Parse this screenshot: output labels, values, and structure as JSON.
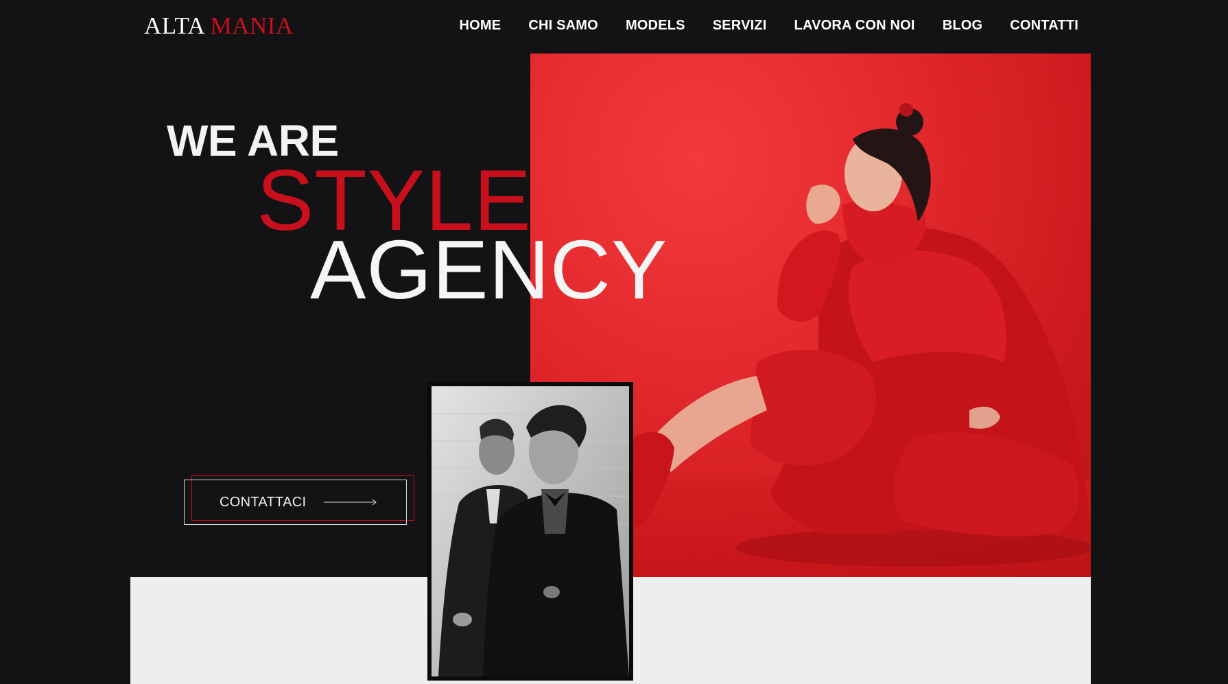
{
  "logo": {
    "part1": "ALTA",
    "part2": "MANIA"
  },
  "nav": {
    "items": [
      {
        "label": "HOME"
      },
      {
        "label": "CHI SAMO"
      },
      {
        "label": "MODELS"
      },
      {
        "label": "SERVIZI"
      },
      {
        "label": "LAVORA CON NOI"
      },
      {
        "label": "BLOG"
      },
      {
        "label": "CONTATTI"
      }
    ]
  },
  "hero": {
    "line1": "WE ARE",
    "line2": "STYLE",
    "line3": "AGENCY",
    "cta_label": "CONTATTACI"
  },
  "images": {
    "main_photo": "woman-in-red-outfit-photo",
    "secondary_photo": "black-and-white-men-in-suits-photo",
    "cta_icon": "arrow-right-icon"
  },
  "colors": {
    "background": "#131214",
    "accent": "#c8101c",
    "text": "#ffffff",
    "band": "#eeeeee"
  }
}
